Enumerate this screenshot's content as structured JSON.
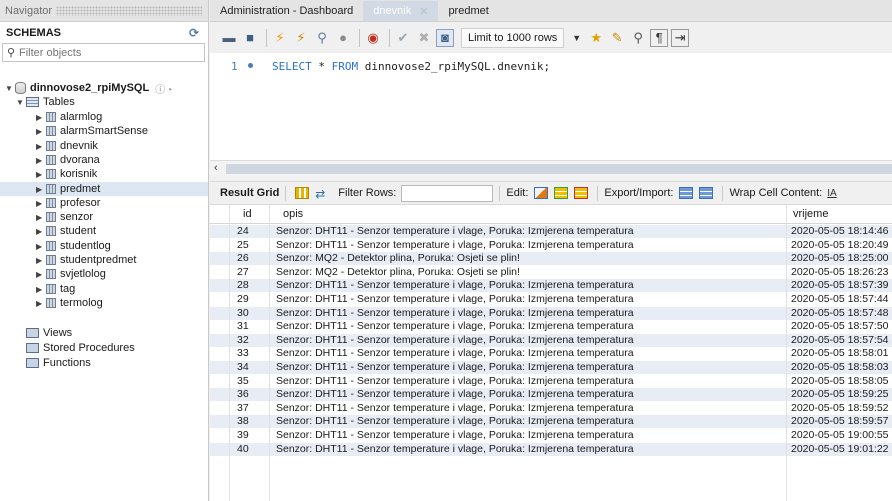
{
  "navigator": {
    "title": "Navigator",
    "schemas_label": "SCHEMAS",
    "filter_placeholder": "Filter objects",
    "schema_name": "dinnovose2_rpiMySQL",
    "tables_label": "Tables",
    "tables": [
      "alarmlog",
      "alarmSmartSense",
      "dnevnik",
      "dvorana",
      "korisnik",
      "predmet",
      "profesor",
      "senzor",
      "student",
      "studentlog",
      "studentpredmet",
      "svjetlolog",
      "tag",
      "termolog"
    ],
    "selected_table": "predmet",
    "views_label": "Views",
    "stored_procedures_label": "Stored Procedures",
    "functions_label": "Functions"
  },
  "tabs": [
    {
      "label": "Administration - Dashboard",
      "active": false
    },
    {
      "label": "dnevnik",
      "active": true
    },
    {
      "label": "predmet",
      "active": false
    }
  ],
  "toolbar": {
    "limit_label": "Limit to 1000 rows"
  },
  "editor": {
    "line_number": "1",
    "sql_select": "SELECT",
    "sql_star": " * ",
    "sql_from": "FROM",
    "sql_target": " dinnovose2_rpiMySQL.dnevnik;"
  },
  "result_toolbar": {
    "result_grid_label": "Result Grid",
    "filter_rows_label": "Filter Rows:",
    "edit_label": "Edit:",
    "export_import_label": "Export/Import:",
    "wrap_label": "Wrap Cell Content:",
    "wrap_icon": "IA"
  },
  "grid": {
    "columns": [
      "id",
      "opis",
      "vrijeme"
    ],
    "rows": [
      {
        "id": "24",
        "opis": "Senzor: DHT11 - Senzor temperature i vlage, Poruka: Izmjerena temperatura",
        "vrijeme": "2020-05-05 18:14:46"
      },
      {
        "id": "25",
        "opis": "Senzor: DHT11 - Senzor temperature i vlage, Poruka: Izmjerena temperatura",
        "vrijeme": "2020-05-05 18:20:49"
      },
      {
        "id": "26",
        "opis": "Senzor: MQ2 - Detektor plina, Poruka: Osjeti se plin!",
        "vrijeme": "2020-05-05 18:25:00"
      },
      {
        "id": "27",
        "opis": "Senzor: MQ2 - Detektor plina, Poruka: Osjeti se plin!",
        "vrijeme": "2020-05-05 18:26:23"
      },
      {
        "id": "28",
        "opis": "Senzor: DHT11 - Senzor temperature i vlage, Poruka: Izmjerena temperatura",
        "vrijeme": "2020-05-05 18:57:39"
      },
      {
        "id": "29",
        "opis": "Senzor: DHT11 - Senzor temperature i vlage, Poruka: Izmjerena temperatura",
        "vrijeme": "2020-05-05 18:57:44"
      },
      {
        "id": "30",
        "opis": "Senzor: DHT11 - Senzor temperature i vlage, Poruka: Izmjerena temperatura",
        "vrijeme": "2020-05-05 18:57:48"
      },
      {
        "id": "31",
        "opis": "Senzor: DHT11 - Senzor temperature i vlage, Poruka: Izmjerena temperatura",
        "vrijeme": "2020-05-05 18:57:50"
      },
      {
        "id": "32",
        "opis": "Senzor: DHT11 - Senzor temperature i vlage, Poruka: Izmjerena temperatura",
        "vrijeme": "2020-05-05 18:57:54"
      },
      {
        "id": "33",
        "opis": "Senzor: DHT11 - Senzor temperature i vlage, Poruka: Izmjerena temperatura",
        "vrijeme": "2020-05-05 18:58:01"
      },
      {
        "id": "34",
        "opis": "Senzor: DHT11 - Senzor temperature i vlage, Poruka: Izmjerena temperatura",
        "vrijeme": "2020-05-05 18:58:03"
      },
      {
        "id": "35",
        "opis": "Senzor: DHT11 - Senzor temperature i vlage, Poruka: Izmjerena temperatura",
        "vrijeme": "2020-05-05 18:58:05"
      },
      {
        "id": "36",
        "opis": "Senzor: DHT11 - Senzor temperature i vlage, Poruka: Izmjerena temperatura",
        "vrijeme": "2020-05-05 18:59:25"
      },
      {
        "id": "37",
        "opis": "Senzor: DHT11 - Senzor temperature i vlage, Poruka: Izmjerena temperatura",
        "vrijeme": "2020-05-05 18:59:52"
      },
      {
        "id": "38",
        "opis": "Senzor: DHT11 - Senzor temperature i vlage, Poruka: Izmjerena temperatura",
        "vrijeme": "2020-05-05 18:59:57"
      },
      {
        "id": "39",
        "opis": "Senzor: DHT11 - Senzor temperature i vlage, Poruka: Izmjerena temperatura",
        "vrijeme": "2020-05-05 19:00:55"
      },
      {
        "id": "40",
        "opis": "Senzor: DHT11 - Senzor temperature i vlage, Poruka: Izmjerena temperatura",
        "vrijeme": "2020-05-05 19:01:22"
      }
    ]
  }
}
